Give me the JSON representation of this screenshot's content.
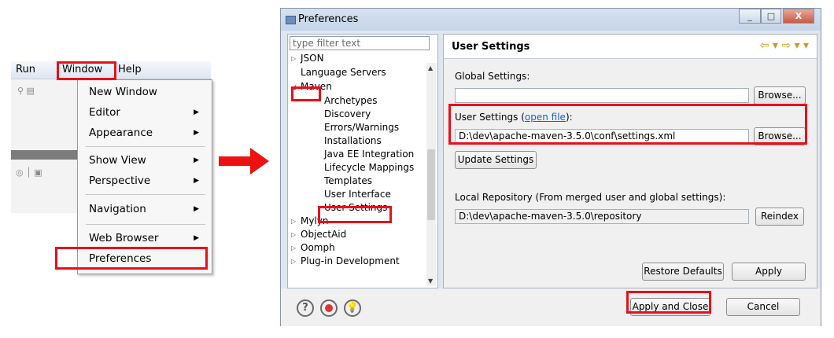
{
  "left_menu": {
    "menubar": [
      "Run",
      "Window",
      "Help"
    ],
    "items": [
      {
        "label": "New Window",
        "submenu": false
      },
      {
        "label": "Editor",
        "submenu": true
      },
      {
        "label": "Appearance",
        "submenu": true
      },
      {
        "label": "Show View",
        "submenu": true
      },
      {
        "label": "Perspective",
        "submenu": true
      },
      {
        "label": "Navigation",
        "submenu": true
      },
      {
        "label": "Web Browser",
        "submenu": true
      },
      {
        "label": "Preferences",
        "submenu": false
      }
    ]
  },
  "dialog": {
    "title": "Preferences",
    "window_buttons": {
      "minimize": "_",
      "maximize": "□",
      "close": "X"
    },
    "filter_placeholder": "type filter text",
    "tree": [
      {
        "label": "JSON",
        "state": "collapsed"
      },
      {
        "label": "Language Servers",
        "state": "leaf"
      },
      {
        "label": "Maven",
        "state": "expanded"
      },
      {
        "label": "Archetypes",
        "state": "child"
      },
      {
        "label": "Discovery",
        "state": "child"
      },
      {
        "label": "Errors/Warnings",
        "state": "child"
      },
      {
        "label": "Installations",
        "state": "child"
      },
      {
        "label": "Java EE Integration",
        "state": "child"
      },
      {
        "label": "Lifecycle Mappings",
        "state": "child"
      },
      {
        "label": "Templates",
        "state": "child"
      },
      {
        "label": "User Interface",
        "state": "child"
      },
      {
        "label": "User Settings",
        "state": "child-selected"
      },
      {
        "label": "Mylyn",
        "state": "collapsed"
      },
      {
        "label": "ObjectAid",
        "state": "collapsed"
      },
      {
        "label": "Oomph",
        "state": "collapsed"
      },
      {
        "label": "Plug-in Development",
        "state": "collapsed"
      }
    ],
    "page_title": "User Settings",
    "global_settings_label": "Global Settings:",
    "global_settings_value": "",
    "user_settings_label": "User Settings (",
    "open_file_link": "open file",
    "user_settings_label_end": "):",
    "user_settings_value": "D:\\dev\\apache-maven-3.5.0\\conf\\settings.xml",
    "browse_label": "Browse...",
    "update_settings_label": "Update Settings",
    "local_repo_label": "Local Repository (From merged user and global settings):",
    "local_repo_value": "D:\\dev\\apache-maven-3.5.0\\repository",
    "reindex_label": "Reindex",
    "restore_defaults_label": "Restore Defaults",
    "apply_label": "Apply",
    "apply_close_label": "Apply and Close",
    "cancel_label": "Cancel"
  },
  "colors": {
    "highlight": "#e8101a",
    "arrow": "#ee1111",
    "link": "#1a5fd0"
  }
}
